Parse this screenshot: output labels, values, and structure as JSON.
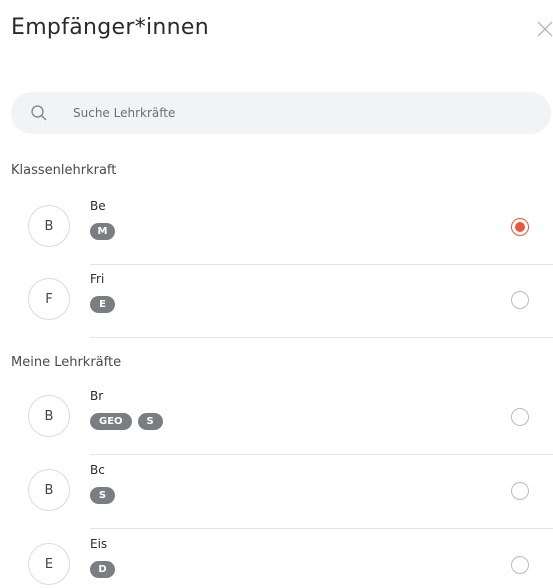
{
  "header": {
    "title": "Empfänger*innen",
    "close_icon": "close-icon"
  },
  "search": {
    "placeholder": "Suche Lehrkräfte",
    "value": "",
    "icon": "search-icon"
  },
  "sections": [
    {
      "label": "Klassenlehrkraft",
      "items": [
        {
          "initial": "B",
          "name": "Be",
          "badges": [
            "M"
          ],
          "selected": true
        },
        {
          "initial": "F",
          "name": "Fri",
          "badges": [
            "E"
          ],
          "selected": false
        }
      ]
    },
    {
      "label": "Meine Lehrkräfte",
      "items": [
        {
          "initial": "B",
          "name": "Br",
          "badges": [
            "GEO",
            "S"
          ],
          "selected": false
        },
        {
          "initial": "B",
          "name": "Bc",
          "badges": [
            "S"
          ],
          "selected": false
        },
        {
          "initial": "E",
          "name": "Eis",
          "badges": [
            "D"
          ],
          "selected": false
        }
      ]
    }
  ],
  "colors": {
    "accent": "#e8553b",
    "badge": "#7a7e83",
    "search_bg": "#f2f3f4"
  }
}
